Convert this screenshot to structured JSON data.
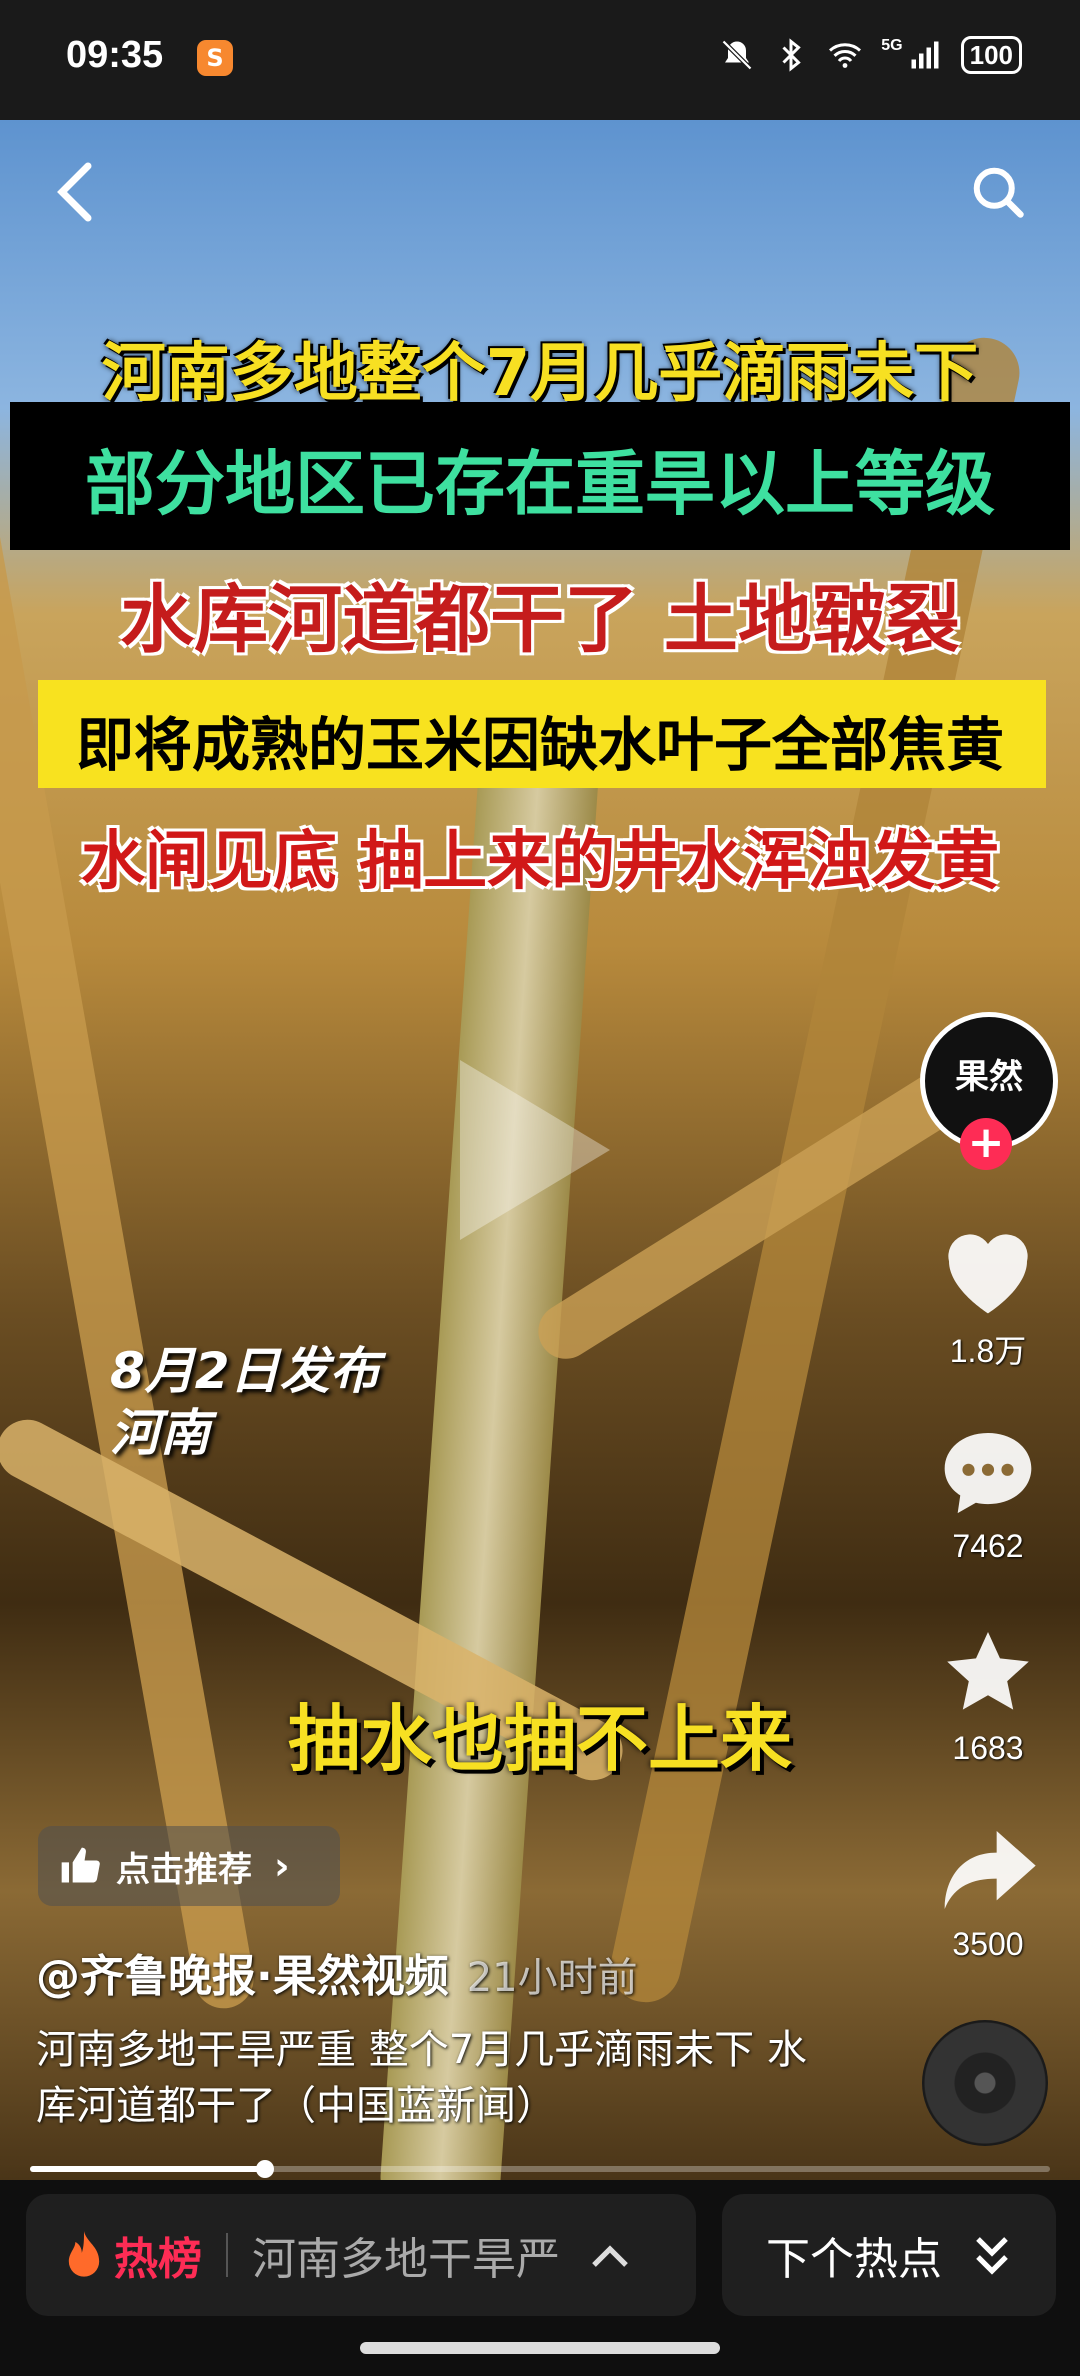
{
  "status_bar": {
    "time": "09:35",
    "app_badge": "S",
    "network_label": "5G",
    "battery": "100"
  },
  "video": {
    "captions": [
      "河南多地整个7月几乎滴雨未下",
      "部分地区已存在重旱以上等级",
      "水库河道都干了 土地皲裂",
      "即将成熟的玉米因缺水叶子全部焦黄",
      "水闸见底 抽上来的井水浑浊发黄"
    ],
    "location_stamp": [
      "8月2日发布",
      "河南"
    ],
    "subtitle": "抽水也抽不上来",
    "progress": 0.23
  },
  "side_actions": {
    "avatar_text": "果然",
    "likes": "1.8万",
    "comments": "7462",
    "favorites": "1683",
    "shares": "3500"
  },
  "post": {
    "recommend_label": "点击推荐",
    "author": "@齐鲁晚报·果然视频",
    "time_ago": "21小时前",
    "description": "河南多地干旱严重 整个7月几乎滴雨未下 水库河道都干了（中国蓝新闻）"
  },
  "bottom_bar": {
    "hot_label": "热榜",
    "hot_topic": "河南多地干旱严",
    "next_label": "下个热点"
  },
  "colors": {
    "accent_red": "#fe2c55",
    "caption_yellow": "#f7e022",
    "caption_green": "#3ee0a0"
  }
}
